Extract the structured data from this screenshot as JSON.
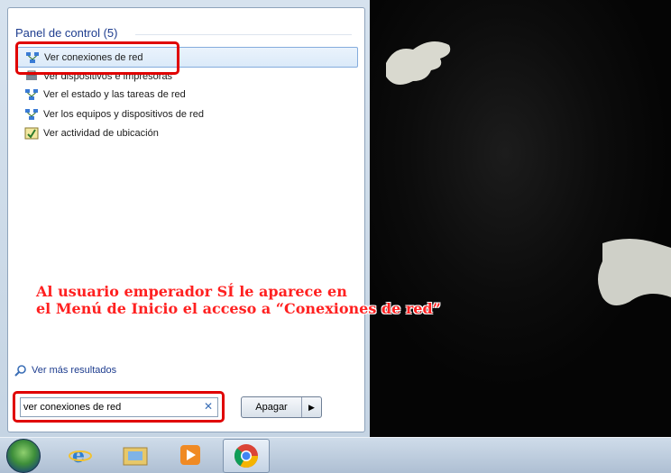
{
  "start_menu": {
    "section_title": "Panel de control (5)",
    "items": [
      {
        "label": "Ver conexiones de red",
        "icon": "network-icon"
      },
      {
        "label": "Ver dispositivos e impresoras",
        "icon": "devices-printers-icon"
      },
      {
        "label": "Ver el estado y las tareas de red",
        "icon": "network-icon"
      },
      {
        "label": "Ver los equipos y dispositivos de red",
        "icon": "network-icon"
      },
      {
        "label": "Ver actividad de ubicación",
        "icon": "location-icon"
      }
    ],
    "more_results": "Ver más resultados",
    "search_value": "ver conexiones de red",
    "shutdown_label": "Apagar"
  },
  "annotation": {
    "line1": "Al usuario emperador SÍ le aparece en",
    "line2": "el Menú de Inicio el acceso a “Conexiones de red”"
  },
  "taskbar": {
    "items": [
      "start-orb",
      "internet-explorer-icon",
      "windows-explorer-icon",
      "media-player-icon",
      "chrome-icon"
    ]
  },
  "colors": {
    "annotation": "#ff2020",
    "highlight_box": "#e00000",
    "link": "#1e3d8f"
  }
}
